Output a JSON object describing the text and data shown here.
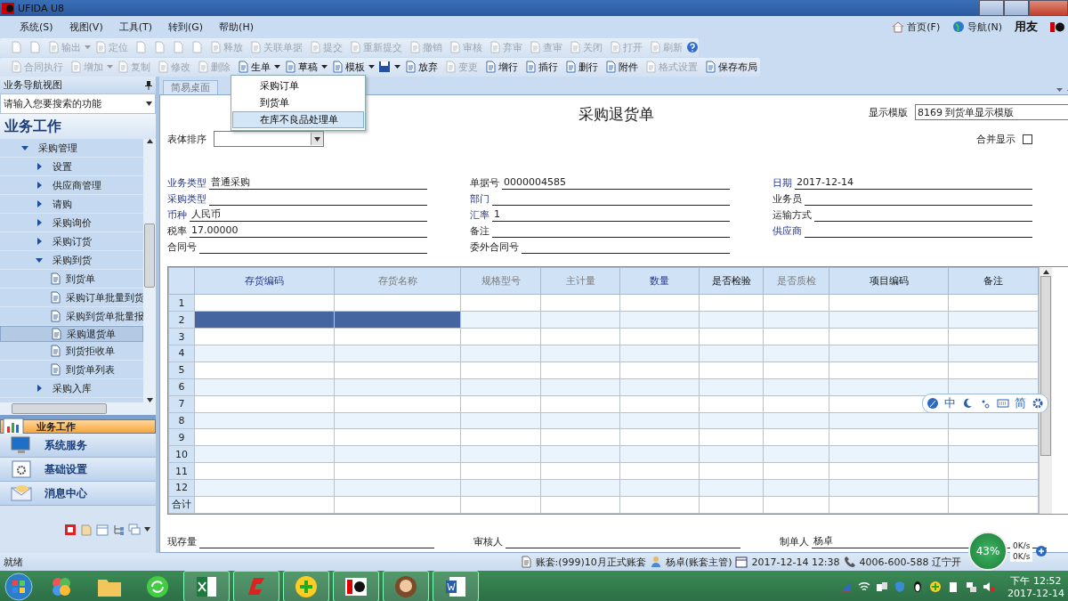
{
  "window": {
    "title": "UFIDA U8"
  },
  "menu": [
    "系统(S)",
    "视图(V)",
    "工具(T)",
    "转到(G)",
    "帮助(H)"
  ],
  "top_links": [
    "首页(F)",
    "导航(N)"
  ],
  "brand": "用友",
  "toolbar_rows": [
    [
      {
        "kind": "icon",
        "disabled": true
      },
      {
        "kind": "icon",
        "disabled": true
      },
      {
        "kind": "button",
        "label": "输出",
        "disabled": true,
        "dropdown": true
      },
      {
        "kind": "button",
        "label": "定位",
        "disabled": true
      },
      {
        "kind": "icon",
        "disabled": true
      },
      {
        "kind": "icon",
        "disabled": true
      },
      {
        "kind": "icon",
        "disabled": true
      },
      {
        "kind": "icon",
        "disabled": true
      },
      {
        "kind": "button",
        "label": "释放",
        "disabled": true
      },
      {
        "kind": "button",
        "label": "关联单据",
        "disabled": true
      },
      {
        "kind": "button",
        "label": "提交",
        "disabled": true
      },
      {
        "kind": "button",
        "label": "重新提交",
        "disabled": true
      },
      {
        "kind": "button",
        "label": "撤销",
        "disabled": true
      },
      {
        "kind": "button",
        "label": "审核",
        "disabled": true
      },
      {
        "kind": "button",
        "label": "弃审",
        "disabled": true
      },
      {
        "kind": "button",
        "label": "查审",
        "disabled": true
      },
      {
        "kind": "button",
        "label": "关闭",
        "disabled": true
      },
      {
        "kind": "button",
        "label": "打开",
        "disabled": true
      },
      {
        "kind": "button",
        "label": "刷新",
        "disabled": true
      },
      {
        "kind": "help",
        "disabled": false
      }
    ],
    [
      {
        "kind": "button",
        "label": "合同执行",
        "disabled": true
      },
      {
        "kind": "button",
        "label": "增加",
        "disabled": true,
        "dropdown": true
      },
      {
        "kind": "button",
        "label": "复制",
        "disabled": true
      },
      {
        "kind": "button",
        "label": "修改",
        "disabled": true
      },
      {
        "kind": "button",
        "label": "删除",
        "disabled": true
      },
      {
        "kind": "button",
        "label": "生单",
        "disabled": false,
        "dropdown": true
      },
      {
        "kind": "button",
        "label": "草稿",
        "disabled": false,
        "dropdown": true
      },
      {
        "kind": "button",
        "label": "模板",
        "disabled": false,
        "dropdown": true
      },
      {
        "kind": "icon",
        "disabled": false,
        "dropdown": true
      },
      {
        "kind": "button",
        "label": "放弃",
        "disabled": false
      },
      {
        "kind": "button",
        "label": "变更",
        "disabled": true
      },
      {
        "kind": "button",
        "label": "增行",
        "disabled": false
      },
      {
        "kind": "button",
        "label": "插行",
        "disabled": false
      },
      {
        "kind": "button",
        "label": "删行",
        "disabled": false
      },
      {
        "kind": "button",
        "label": "附件",
        "disabled": false
      },
      {
        "kind": "button",
        "label": "格式设置",
        "disabled": true
      },
      {
        "kind": "button",
        "label": "保存布局",
        "disabled": false
      }
    ]
  ],
  "dropdown_menu": [
    {
      "label": "采购订单",
      "selected": false
    },
    {
      "label": "到货单",
      "selected": false
    },
    {
      "label": "在库不良品处理单",
      "selected": true
    }
  ],
  "sidebar": {
    "title": "业务导航视图",
    "search": {
      "placeholder": "请输入您要搜索的功能"
    },
    "heading": "业务工作",
    "tree": [
      {
        "label": "采购管理",
        "expanded": true,
        "children": [
          {
            "label": "设置",
            "expanded": false
          },
          {
            "label": "供应商管理",
            "expanded": false
          },
          {
            "label": "请购",
            "expanded": false
          },
          {
            "label": "采购询价",
            "expanded": false
          },
          {
            "label": "采购订货",
            "expanded": false
          },
          {
            "label": "采购到货",
            "expanded": true,
            "children": [
              {
                "label": "到货单",
                "selected": false
              },
              {
                "label": "采购订单批量到货",
                "selected": false
              },
              {
                "label": "采购到货单批量报",
                "selected": false
              },
              {
                "label": "采购退货单",
                "selected": true
              },
              {
                "label": "到货拒收单",
                "selected": false
              },
              {
                "label": "到货单列表",
                "selected": false
              }
            ]
          },
          {
            "label": "采购入库",
            "expanded": false
          }
        ]
      }
    ],
    "nav": [
      {
        "label": "业务工作",
        "kind": "chart",
        "selected": true
      },
      {
        "label": "系统服务",
        "kind": "monitor",
        "selected": false
      },
      {
        "label": "基础设置",
        "kind": "gear",
        "selected": false
      },
      {
        "label": "消息中心",
        "kind": "mail",
        "selected": false
      }
    ]
  },
  "tabs": [
    {
      "label": "简易桌面",
      "selected": false
    }
  ],
  "form": {
    "title": "采购退货单",
    "template_label": "显示模版",
    "template_value": "8169 到货单显示模版",
    "sort_label": "表体排序",
    "merge_label": "合并显示",
    "merge_checked": false,
    "fields": [
      [
        {
          "label": "业务类型",
          "value": "普通采购",
          "link": true
        },
        {
          "label": "采购类型",
          "link": true
        },
        {
          "label": "币种",
          "value": "人民币",
          "link": true
        },
        {
          "label": "税率",
          "value": "17.00000",
          "link": false
        },
        {
          "label": "合同号",
          "link": false
        }
      ],
      [
        {
          "label": "单据号",
          "value": "0000004585",
          "link": false
        },
        {
          "label": "部门",
          "link": true
        },
        {
          "label": "汇率",
          "value": "1",
          "link": true
        },
        {
          "label": "备注",
          "link": false
        },
        {
          "label": "委外合同号",
          "link": false
        }
      ],
      [
        {
          "label": "日期",
          "value": "2017-12-14",
          "link": true
        },
        {
          "label": "业务员",
          "link": false
        },
        {
          "label": "运输方式",
          "link": false
        },
        {
          "label": "供应商",
          "link": true
        }
      ]
    ],
    "table": {
      "columns": [
        {
          "label": "存货编码",
          "kind": "ref"
        },
        {
          "label": "存货名称",
          "kind": "grey"
        },
        {
          "label": "规格型号",
          "kind": "grey"
        },
        {
          "label": "主计量",
          "kind": "grey"
        },
        {
          "label": "数量",
          "kind": "ref"
        },
        {
          "label": "是否检验",
          "kind": "plain"
        },
        {
          "label": "是否质检",
          "kind": "grey"
        },
        {
          "label": "项目编码",
          "kind": "plain"
        },
        {
          "label": "备注",
          "kind": "plain"
        }
      ],
      "rows": [
        {
          "num": "1",
          "selected": false
        },
        {
          "num": "2",
          "selected": true
        },
        {
          "num": "3",
          "selected": false
        },
        {
          "num": "4",
          "selected": false
        },
        {
          "num": "5",
          "selected": false
        },
        {
          "num": "6",
          "selected": false
        },
        {
          "num": "7",
          "selected": false
        },
        {
          "num": "8",
          "selected": false
        },
        {
          "num": "9",
          "selected": false
        },
        {
          "num": "10",
          "selected": false
        },
        {
          "num": "11",
          "selected": false
        },
        {
          "num": "12",
          "selected": false
        }
      ],
      "total_label": "合计"
    },
    "footer": [
      {
        "label": "现存量"
      },
      {
        "label": "审核人"
      },
      {
        "label": "制单人",
        "value": "杨卓"
      }
    ]
  },
  "ime": {
    "mode": "中",
    "script": "简"
  },
  "network": {
    "percent": "43%",
    "up": "0K/s",
    "down": "0K/s"
  },
  "status_bar": {
    "left": "就绪",
    "account": "账套:(999)10月正式账套",
    "user": "杨卓(账套主管)",
    "datetime": "2017-12-14 12:38",
    "phone": "4006-600-588 辽宁开"
  },
  "taskbar": {
    "time": "下午 12:52",
    "date": "2017-12-14"
  }
}
